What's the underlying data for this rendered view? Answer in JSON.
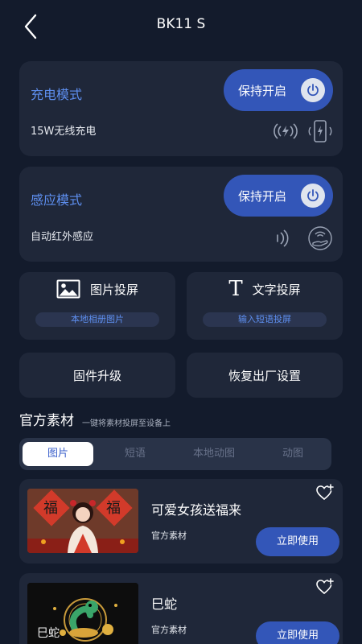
{
  "header": {
    "title": "BK11 S"
  },
  "charge_mode": {
    "title": "充电模式",
    "subtitle": "15W无线充电",
    "button_label": "保持开启"
  },
  "sense_mode": {
    "title": "感应模式",
    "subtitle": "自动红外感应",
    "button_label": "保持开启"
  },
  "tiles": {
    "image_cast": {
      "title": "图片投屏",
      "action": "本地相册图片"
    },
    "text_cast": {
      "title": "文字投屏",
      "action": "输入短语投屏"
    },
    "firmware": "固件升级",
    "factory_reset": "恢复出厂设置"
  },
  "text_icon_glyph": "T",
  "section": {
    "title": "官方素材",
    "subtitle": "一键将素材投屏至设备上"
  },
  "tabs": [
    {
      "label": "图片",
      "active": true
    },
    {
      "label": "短语",
      "active": false
    },
    {
      "label": "本地动图",
      "active": false
    },
    {
      "label": "动图",
      "active": false
    }
  ],
  "materials": [
    {
      "name": "可爱女孩送福来",
      "source": "官方素材",
      "action": "立即使用",
      "thumb_chars": [
        "福",
        "福"
      ]
    },
    {
      "name": "巳蛇",
      "source": "官方素材",
      "action": "立即使用",
      "thumb_text": "巳蛇"
    }
  ],
  "colors": {
    "accent": "#3356b8",
    "accent_text": "#5e8ff0",
    "card": "#1f2739",
    "background": "#131b2c"
  },
  "icons": {
    "back": "chevron-left-icon",
    "power": "power-icon",
    "wireless_charge": "wireless-charging-icon",
    "phone_charge": "phone-charging-icon",
    "infrared": "infrared-signal-icon",
    "hand_sense": "hand-sensor-icon",
    "image": "image-icon",
    "text": "text-icon",
    "favorite": "heart-plus-icon"
  }
}
